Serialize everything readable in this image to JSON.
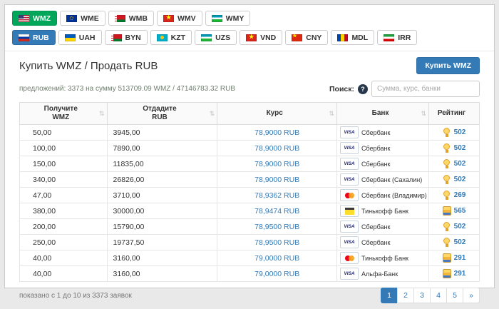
{
  "wm_tabs": [
    {
      "label": "WMZ",
      "flag": "us",
      "active": true
    },
    {
      "label": "WME",
      "flag": "eu",
      "active": false
    },
    {
      "label": "WMB",
      "flag": "by",
      "active": false
    },
    {
      "label": "WMV",
      "flag": "vn",
      "active": false
    },
    {
      "label": "WMY",
      "flag": "uz",
      "active": false
    }
  ],
  "currency_tabs": [
    {
      "label": "RUB",
      "flag": "ru",
      "active": true
    },
    {
      "label": "UAH",
      "flag": "ua",
      "active": false
    },
    {
      "label": "BYN",
      "flag": "by",
      "active": false
    },
    {
      "label": "KZT",
      "flag": "kz",
      "active": false
    },
    {
      "label": "UZS",
      "flag": "uz",
      "active": false
    },
    {
      "label": "VND",
      "flag": "vn",
      "active": false
    },
    {
      "label": "CNY",
      "flag": "cn",
      "active": false
    },
    {
      "label": "MDL",
      "flag": "md",
      "active": false
    },
    {
      "label": "IRR",
      "flag": "ir",
      "active": false
    }
  ],
  "page": {
    "title": "Купить WMZ / Продать RUB",
    "buy_button": "Купить WMZ",
    "summary": "предложений: 3373 на сумму 513709.09 WMZ / 47146783.32 RUB"
  },
  "search": {
    "label": "Поиск:",
    "info_glyph": "?",
    "placeholder": "Сумма, курс, банки"
  },
  "icons": {
    "visa_label": "VISA"
  },
  "table": {
    "headers": [
      {
        "key": "receive",
        "lines": [
          "Получите",
          "WMZ"
        ],
        "sortable": true
      },
      {
        "key": "give",
        "lines": [
          "Отдадите",
          "RUB"
        ],
        "sortable": true
      },
      {
        "key": "rate",
        "lines": [
          "Курс"
        ],
        "sortable": true
      },
      {
        "key": "bank",
        "lines": [
          "Банк"
        ],
        "sortable": true
      },
      {
        "key": "rating",
        "lines": [
          "Рейтинг"
        ],
        "sortable": false
      }
    ],
    "rows": [
      {
        "receive": "50,00",
        "give": "3945,00",
        "rate": "78,9000 RUB",
        "card": "visa",
        "bank": "Сбербанк",
        "rating": "502",
        "medal": "cup"
      },
      {
        "receive": "100,00",
        "give": "7890,00",
        "rate": "78,9000 RUB",
        "card": "visa",
        "bank": "Сбербанк",
        "rating": "502",
        "medal": "cup"
      },
      {
        "receive": "150,00",
        "give": "11835,00",
        "rate": "78,9000 RUB",
        "card": "visa",
        "bank": "Сбербанк",
        "rating": "502",
        "medal": "cup"
      },
      {
        "receive": "340,00",
        "give": "26826,00",
        "rate": "78,9000 RUB",
        "card": "visa",
        "bank": "Сбербанк (Сахалин)",
        "rating": "502",
        "medal": "cup"
      },
      {
        "receive": "47,00",
        "give": "3710,00",
        "rate": "78,9362 RUB",
        "card": "mastercard",
        "bank": "Сбербанк (Владимир)",
        "rating": "269",
        "medal": "cup"
      },
      {
        "receive": "380,00",
        "give": "30000,00",
        "rate": "78,9474 RUB",
        "card": "tinkoff",
        "bank": "Тинькофф Банк",
        "rating": "565",
        "medal": "stack"
      },
      {
        "receive": "200,00",
        "give": "15790,00",
        "rate": "78,9500 RUB",
        "card": "visa",
        "bank": "Сбербанк",
        "rating": "502",
        "medal": "cup"
      },
      {
        "receive": "250,00",
        "give": "19737,50",
        "rate": "78,9500 RUB",
        "card": "visa",
        "bank": "Сбербанк",
        "rating": "502",
        "medal": "cup"
      },
      {
        "receive": "40,00",
        "give": "3160,00",
        "rate": "79,0000 RUB",
        "card": "mastercard",
        "bank": "Тинькофф Банк",
        "rating": "291",
        "medal": "stack"
      },
      {
        "receive": "40,00",
        "give": "3160,00",
        "rate": "79,0000 RUB",
        "card": "visa",
        "bank": "Альфа-Банк",
        "rating": "291",
        "medal": "stack"
      }
    ]
  },
  "footer": {
    "shown": "показано с 1 до 10 из 3373 заявок",
    "pages": [
      {
        "label": "1",
        "active": true
      },
      {
        "label": "2",
        "active": false
      },
      {
        "label": "3",
        "active": false
      },
      {
        "label": "4",
        "active": false
      },
      {
        "label": "5",
        "active": false
      },
      {
        "label": "»",
        "active": false
      }
    ]
  },
  "colors": {
    "accent_green": "#00a65a",
    "accent_blue": "#337ab7",
    "rate_text": "#337ab7"
  }
}
